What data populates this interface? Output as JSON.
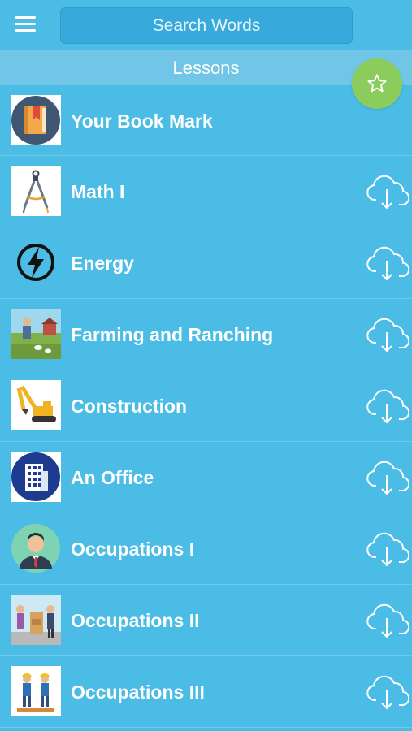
{
  "search": {
    "placeholder": "Search Words"
  },
  "section": {
    "title": "Lessons"
  },
  "lessons": [
    {
      "label": "Your Book Mark",
      "icon": "bookmark-book-icon",
      "download": false
    },
    {
      "label": "Math I",
      "icon": "drafting-compass-icon",
      "download": true
    },
    {
      "label": "Energy",
      "icon": "lightning-bolt-icon",
      "download": true
    },
    {
      "label": "Farming and Ranching",
      "icon": "farm-scene-icon",
      "download": true
    },
    {
      "label": "Construction",
      "icon": "excavator-icon",
      "download": true
    },
    {
      "label": "An Office",
      "icon": "office-building-icon",
      "download": true
    },
    {
      "label": "Occupations I",
      "icon": "businessman-avatar-icon",
      "download": true
    },
    {
      "label": "Occupations II",
      "icon": "workers-scene-icon",
      "download": true
    },
    {
      "label": "Occupations III",
      "icon": "builders-icon",
      "download": true
    }
  ],
  "colors": {
    "background": "#4bbce6",
    "header_strip": "#71c6e7",
    "favorite": "#8ccc5c"
  }
}
